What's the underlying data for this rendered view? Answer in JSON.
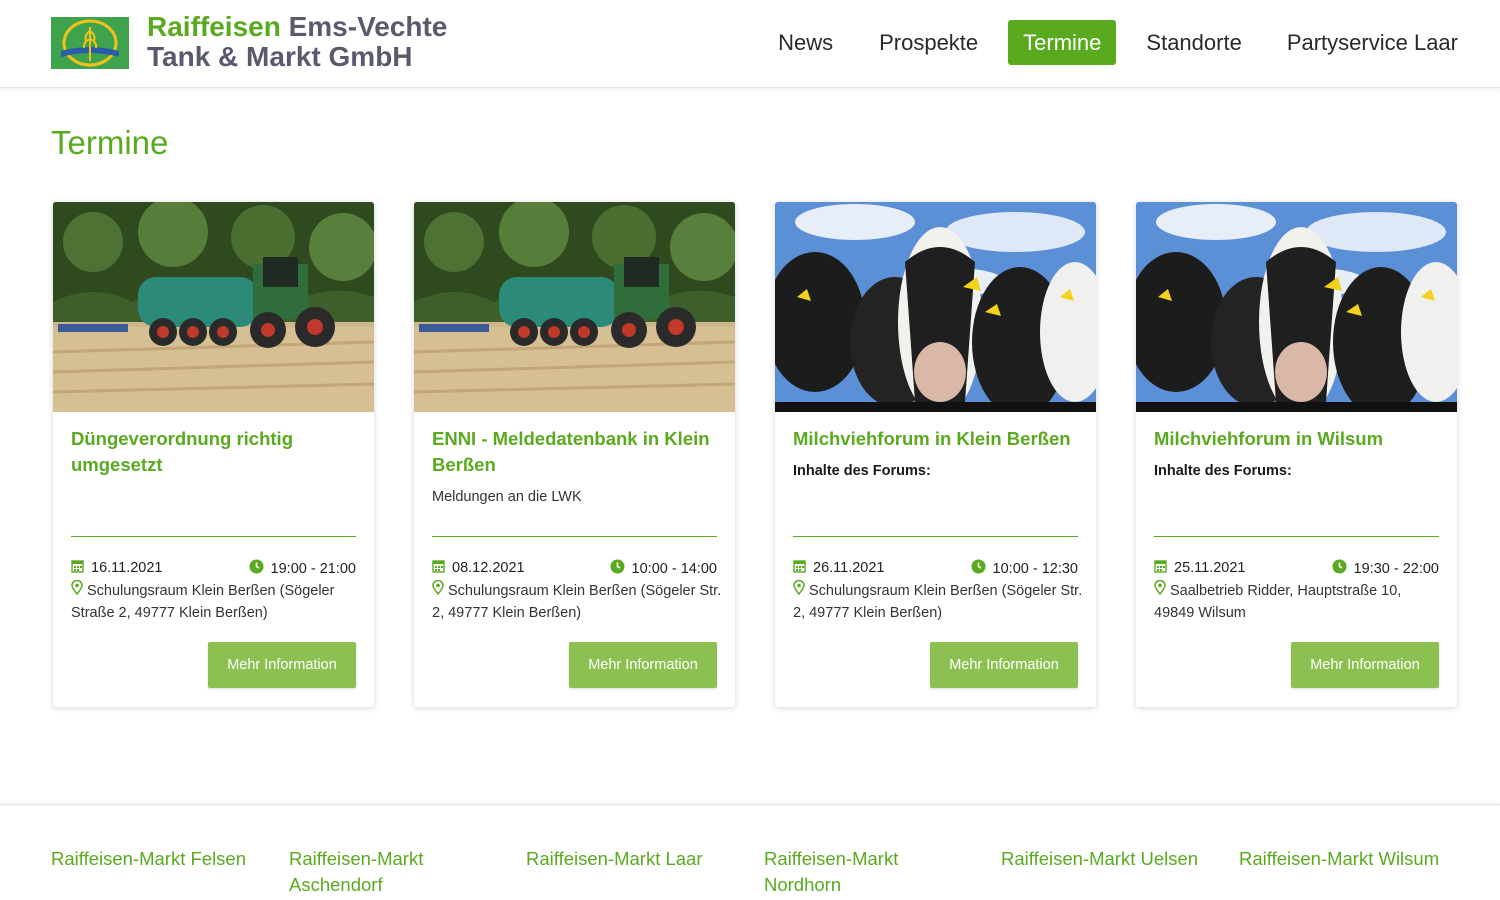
{
  "brand": {
    "line1_green": "Raiffeisen",
    "line1_gray": " Ems-Vechte",
    "line2": "Tank & Markt GmbH"
  },
  "nav": {
    "items": [
      {
        "label": "News"
      },
      {
        "label": "Prospekte"
      },
      {
        "label": "Termine",
        "active": true
      },
      {
        "label": "Standorte"
      },
      {
        "label": "Partyservice Laar"
      }
    ]
  },
  "page": {
    "title": "Termine"
  },
  "cards": [
    {
      "image": "tractor-slurry-tanker",
      "title": "Düngeverordnung richtig umgesetzt",
      "subtitle": "",
      "date": "16.11.2021",
      "time": "19:00 - 21:00",
      "location": "Schulungsraum Klein Berßen (Sögeler Straße 2, 49777 Klein Berßen)",
      "button": "Mehr Information"
    },
    {
      "image": "tractor-slurry-tanker",
      "title": "ENNI - Meldedatenbank in Klein Berßen",
      "subtitle": "Meldungen an die LWK",
      "date": "08.12.2021",
      "time": "10:00 - 14:00",
      "location": "Schulungsraum Klein Berßen (Sögeler Str. 2, 49777 Klein Berßen)",
      "button": "Mehr Information"
    },
    {
      "image": "dairy-cows",
      "title": "Milchviehforum in Klein Berßen",
      "subtitle": "Inhalte des Forums:",
      "date": "26.11.2021",
      "time": "10:00 - 12:30",
      "location": "Schulungsraum Klein Berßen (Sögeler Str. 2, 49777 Klein Berßen)",
      "button": "Mehr Information"
    },
    {
      "image": "dairy-cows",
      "title": "Milchviehforum in Wilsum",
      "subtitle": "Inhalte des Forums:",
      "date": "25.11.2021",
      "time": "19:30 - 22:00",
      "location": "Saalbetrieb Ridder, Hauptstraße 10, 49849 Wilsum",
      "button": "Mehr Information"
    }
  ],
  "footer": {
    "links": [
      "Raiffeisen-Markt Felsen",
      "Raiffeisen-Markt Aschendorf",
      "Raiffeisen-Markt Laar",
      "Raiffeisen-Markt Nordhorn",
      "Raiffeisen-Markt Uelsen",
      "Raiffeisen-Markt Wilsum"
    ]
  },
  "colors": {
    "accent": "#5aaa1f",
    "button": "#8cc152",
    "brand_gray": "#5a5a6e"
  }
}
